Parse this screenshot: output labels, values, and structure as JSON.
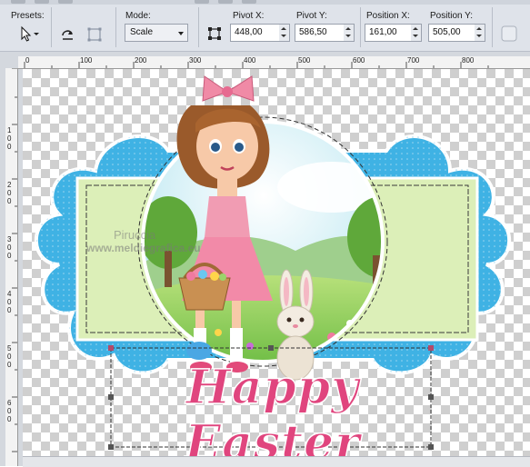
{
  "toolbar": {
    "presets_label": "Presets:",
    "mode_label": "Mode:",
    "mode_value": "Scale",
    "pivot_x_label": "Pivot X:",
    "pivot_x_value": "448,00",
    "pivot_y_label": "Pivot Y:",
    "pivot_y_value": "586,50",
    "position_x_label": "Position X:",
    "position_x_value": "161,00",
    "position_y_label": "Position Y:",
    "position_y_value": "505,00"
  },
  "ruler": {
    "h_labels": [
      "0",
      "100",
      "200",
      "300",
      "400",
      "500",
      "600",
      "700",
      "800"
    ],
    "v_labels": [
      "1\n0\n0",
      "2\n0\n0",
      "3\n0\n0",
      "4\n0\n0",
      "5\n0\n0",
      "6\n0\n0"
    ]
  },
  "artwork": {
    "headline": "Happy Easter",
    "watermark_line1": "Piruccia",
    "watermark_line2": "www.meldiegrafica.eu"
  },
  "colors": {
    "scallop_blue": "#3fb2e4",
    "frame_green": "#d8ecb0",
    "title_pink": "#e0457e",
    "bow_pink": "#f08aa6",
    "dress_pink": "#f19cb3",
    "selection_handle": "#b24a6a"
  }
}
